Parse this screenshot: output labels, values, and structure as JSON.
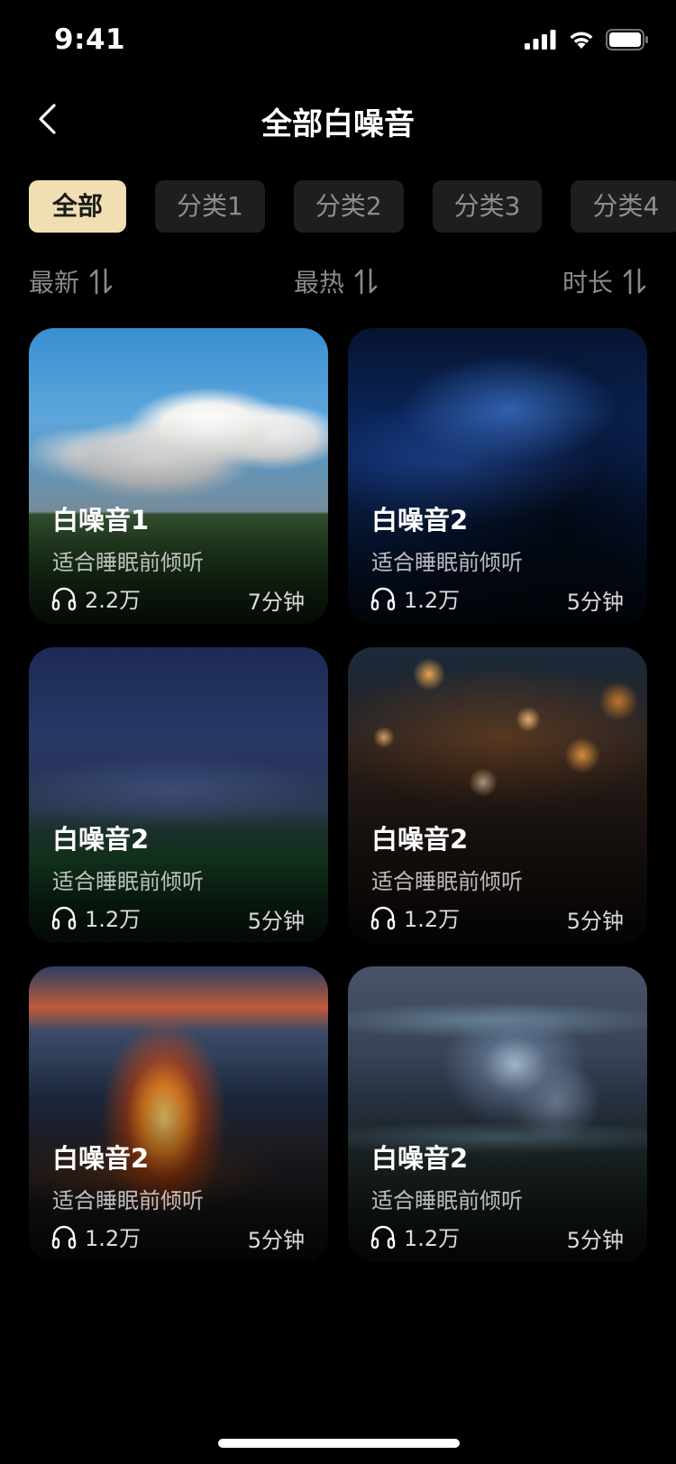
{
  "status_bar": {
    "time": "9:41"
  },
  "header": {
    "title": "全部白噪音",
    "back_icon": "chevron-left-icon"
  },
  "categories": [
    {
      "label": "全部",
      "active": true
    },
    {
      "label": "分类1",
      "active": false
    },
    {
      "label": "分类2",
      "active": false
    },
    {
      "label": "分类3",
      "active": false
    },
    {
      "label": "分类4",
      "active": false
    }
  ],
  "sort": {
    "latest": "最新",
    "hottest": "最热",
    "duration": "时长",
    "icon": "sort-arrows-icon"
  },
  "cards": [
    {
      "title": "白噪音1",
      "subtitle": "适合睡眠前倾听",
      "plays": "2.2万",
      "duration": "7分钟",
      "scene": "bg-sky"
    },
    {
      "title": "白噪音2",
      "subtitle": "适合睡眠前倾听",
      "plays": "1.2万",
      "duration": "5分钟",
      "scene": "bg-night"
    },
    {
      "title": "白噪音2",
      "subtitle": "适合睡眠前倾听",
      "plays": "1.2万",
      "duration": "5分钟",
      "scene": "bg-stars-mountain"
    },
    {
      "title": "白噪音2",
      "subtitle": "适合睡眠前倾听",
      "plays": "1.2万",
      "duration": "5分钟",
      "scene": "bg-rain"
    },
    {
      "title": "白噪音2",
      "subtitle": "适合睡眠前倾听",
      "plays": "1.2万",
      "duration": "5分钟",
      "scene": "bg-fire"
    },
    {
      "title": "白噪音2",
      "subtitle": "适合睡眠前倾听",
      "plays": "1.2万",
      "duration": "5分钟",
      "scene": "bg-speaker"
    }
  ],
  "colors": {
    "background": "#000000",
    "chip_active": "#f1dfb3",
    "chip_inactive": "#1e1e1e",
    "muted_text": "#8a8a8a"
  }
}
